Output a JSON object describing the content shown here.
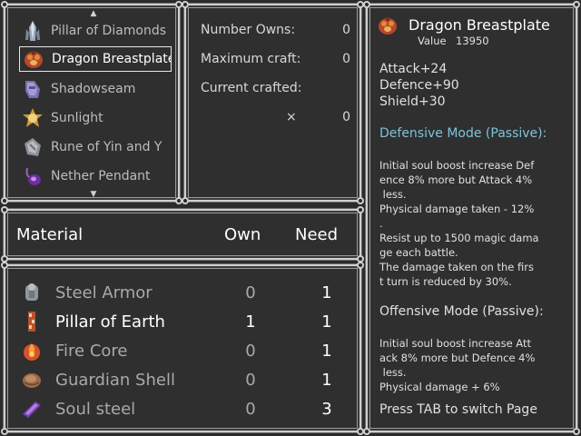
{
  "recipes": [
    {
      "label": "Pillar of Diamonds",
      "icon": "pillar-of-diamonds-icon",
      "selected": false
    },
    {
      "label": "Dragon Breastplate",
      "icon": "dragon-breastplate-icon",
      "selected": true
    },
    {
      "label": "Shadowseam",
      "icon": "shadowseam-icon",
      "selected": false
    },
    {
      "label": "Sunlight",
      "icon": "sunlight-icon",
      "selected": false
    },
    {
      "label": "Rune of Yin and Y",
      "icon": "rune-icon",
      "selected": false
    },
    {
      "label": "Nether Pendant",
      "icon": "nether-pendant-icon",
      "selected": false
    }
  ],
  "stats": {
    "number_owns_label": "Number Owns:",
    "number_owns_value": "0",
    "max_craft_label": "Maximum craft:",
    "max_craft_value": "0",
    "current_crafted_label": "Current crafted:",
    "multiplier": "×",
    "current_crafted_value": "0"
  },
  "materials_header": {
    "material": "Material",
    "own": "Own",
    "need": "Need"
  },
  "materials": [
    {
      "name": "Steel Armor",
      "own": "0",
      "need": "1",
      "icon": "steel-armor-icon",
      "enough": false
    },
    {
      "name": "Pillar of Earth",
      "own": "1",
      "need": "1",
      "icon": "pillar-of-earth-icon",
      "enough": true
    },
    {
      "name": "Fire Core",
      "own": "0",
      "need": "1",
      "icon": "fire-core-icon",
      "enough": false
    },
    {
      "name": "Guardian Shell",
      "own": "0",
      "need": "1",
      "icon": "guardian-shell-icon",
      "enough": false
    },
    {
      "name": "Soul steel",
      "own": "0",
      "need": "3",
      "icon": "soul-steel-icon",
      "enough": false
    }
  ],
  "detail": {
    "title": "Dragon Breastplate",
    "value_label": "Value",
    "value": "13950",
    "attack": "Attack+24",
    "defence": "Defence+90",
    "shield": "Shield+30",
    "defensive_mode": "Defensive Mode (Passive):",
    "defensive_lines": [
      "Initial soul boost increase Def",
      "ence 8% more but Attack 4%",
      " less.",
      "Physical damage taken - 12%",
      ".",
      "Resist up to 1500 magic dama",
      "ge each battle.",
      "The damage taken on the firs",
      "t turn is reduced by 30%."
    ],
    "offensive_mode": "Offensive Mode (Passive):",
    "offensive_lines": [
      "Initial soul boost increase Att",
      "ack 8% more but Defence 4%",
      " less.",
      "Physical damage + 6%"
    ],
    "hint": "Press TAB to switch Page"
  },
  "colors": {
    "accent": "#7fc3d9",
    "bg": "#2f2f2f",
    "border": "#cfcfcf",
    "dim_text": "#a9a9a9"
  }
}
